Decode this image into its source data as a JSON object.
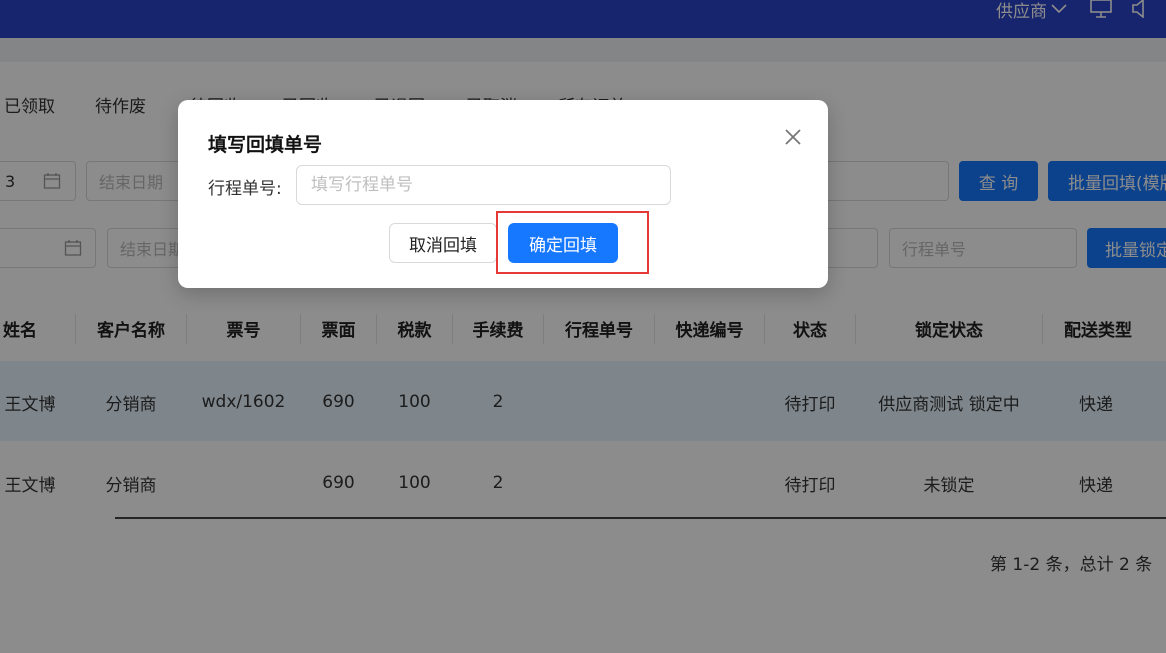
{
  "header": {
    "supplier_menu": "供应商",
    "icons": [
      "chevron-down-icon",
      "monitor-icon",
      "speaker-icon"
    ],
    "bg_color": "#2a42c8"
  },
  "tabs": [
    "已领取",
    "待作废",
    "待回收",
    "已回收",
    "已退回",
    "已取消",
    "所有订单"
  ],
  "filters": {
    "row1": {
      "date_value": "3",
      "end_date_placeholder": "结束日期",
      "query_button": "查 询",
      "batch_fill_button": "批量回填(模版"
    },
    "row2": {
      "end_date_placeholder": "结束日期",
      "trip_number_placeholder": "行程单号",
      "batch_lock_button": "批量锁定"
    }
  },
  "table": {
    "columns": [
      "姓名",
      "客户名称",
      "票号",
      "票面",
      "税款",
      "手续费",
      "行程单号",
      "快递编号",
      "状态",
      "锁定状态",
      "配送类型"
    ],
    "rows": [
      {
        "name": "王文博",
        "customer": "分销商",
        "ticket_no": "wdx/1602",
        "face": "690",
        "tax": "100",
        "fee": "2",
        "trip_no": "",
        "express_no": "",
        "status": "待打印",
        "lock": "供应商测试 锁定中",
        "delivery": "快递"
      },
      {
        "name": "王文博",
        "customer": "分销商",
        "ticket_no": "",
        "face": "690",
        "tax": "100",
        "fee": "2",
        "trip_no": "",
        "express_no": "",
        "status": "待打印",
        "lock": "未锁定",
        "delivery": "快递"
      }
    ],
    "pagination": "第 1-2 条，总计 2 条"
  },
  "modal": {
    "title": "填写回填单号",
    "field_label": "行程单号:",
    "field_placeholder": "填写行程单号",
    "field_value": "",
    "cancel_button": "取消回填",
    "confirm_button": "确定回填"
  },
  "colors": {
    "primary": "#1677ff",
    "highlight": "#e53935",
    "selected_row": "#e6f4ff"
  }
}
